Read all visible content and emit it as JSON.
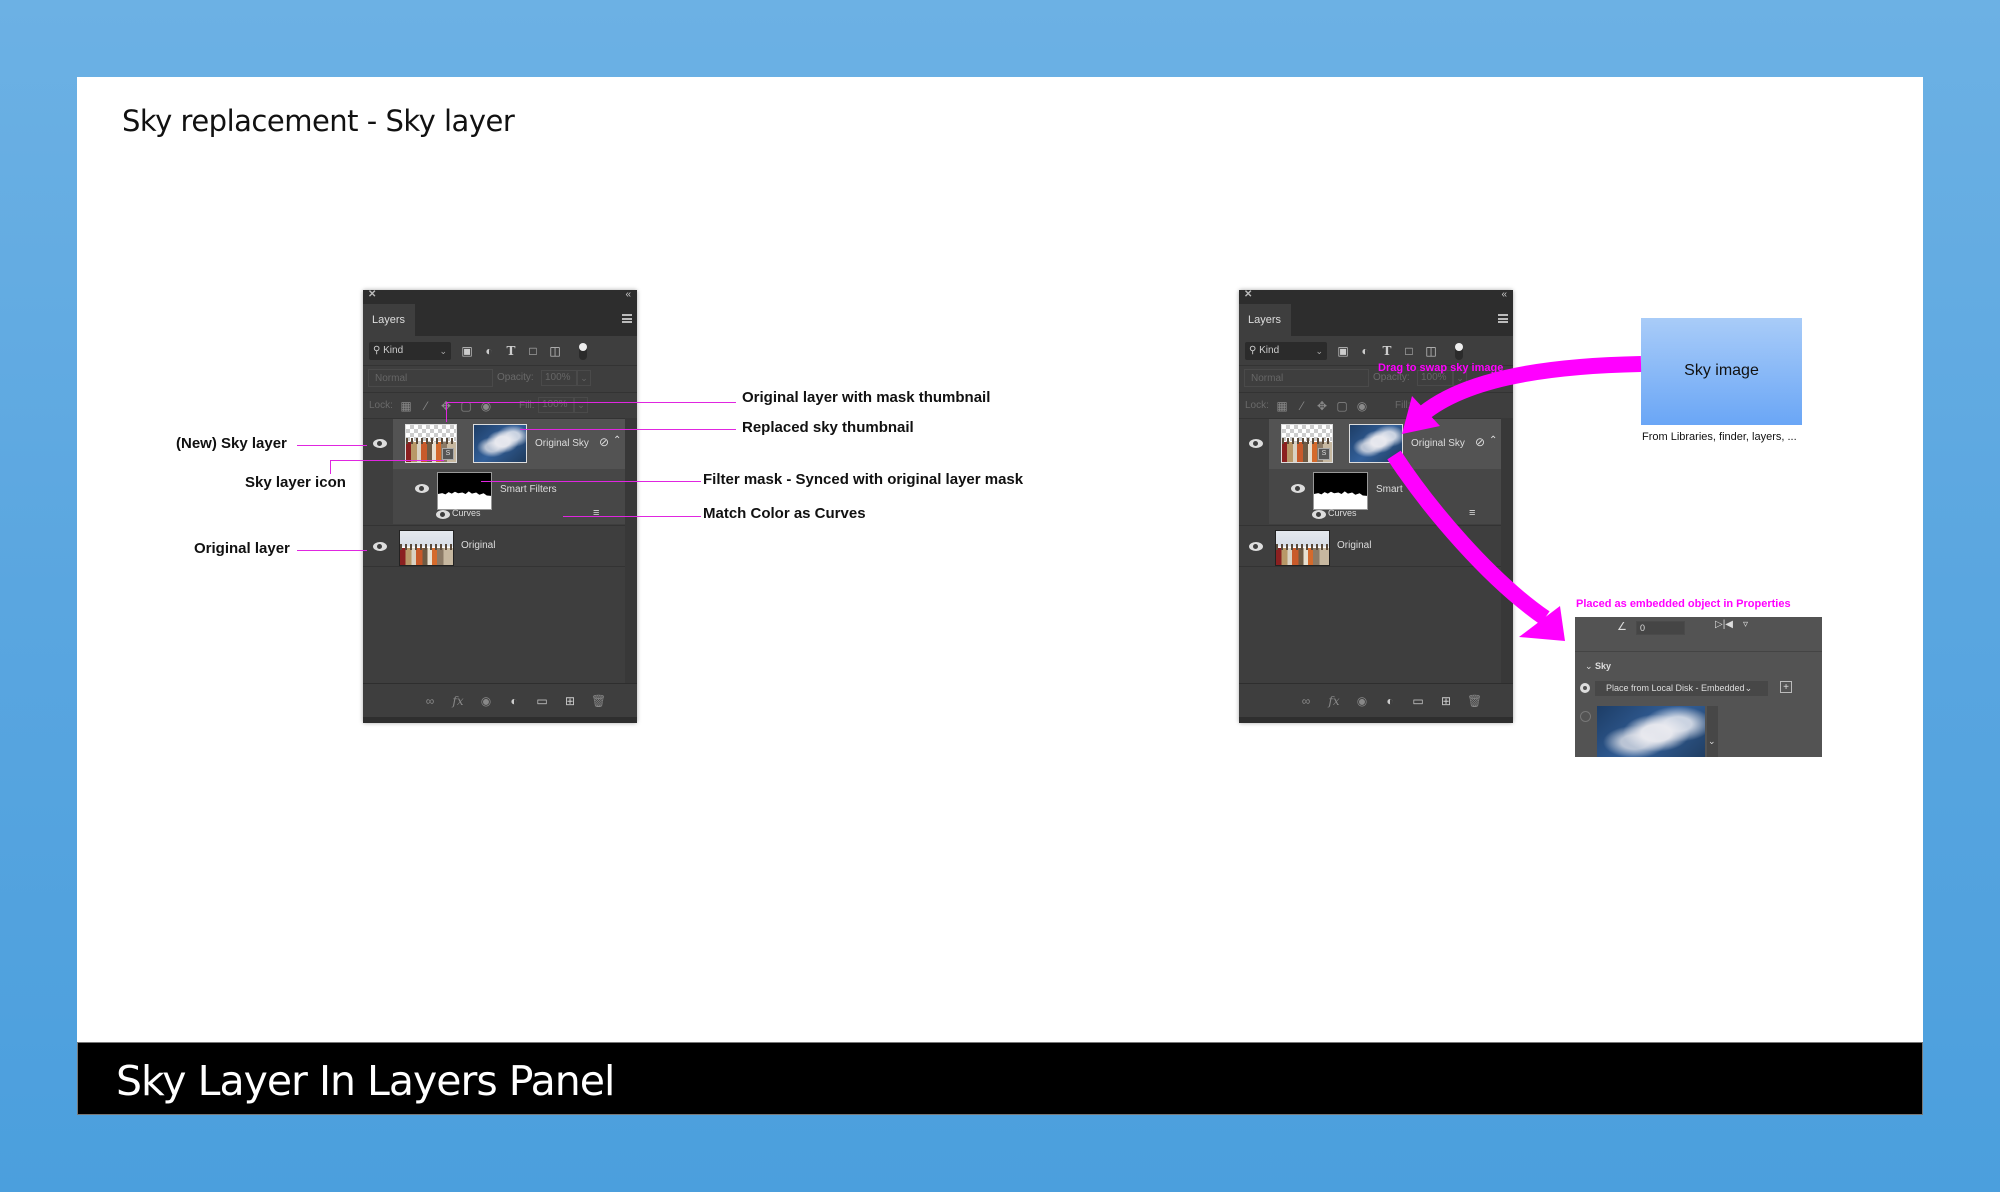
{
  "slide": {
    "title": "Sky replacement - Sky layer",
    "caption": "Sky Layer In Layers Panel"
  },
  "colors": {
    "accent_magenta": "#ff00ff",
    "annotation_line": "#e026e0",
    "panel_bg": "#3e3e3e",
    "sky_box_top": "#a9ccf8",
    "sky_box_bottom": "#6aa6f6"
  },
  "layers_panel": {
    "close_icon": "✕",
    "collapse_icon": "«",
    "tab_label": "Layers",
    "filter": {
      "kind_label": "Kind",
      "icons": [
        "pixel-filter-icon",
        "adjustment-filter-icon",
        "type-filter-icon",
        "shape-filter-icon",
        "smart-object-filter-icon",
        "filter-toggle"
      ]
    },
    "blend_mode": "Normal",
    "opacity_label": "Opacity:",
    "opacity_value": "100%",
    "lock_label": "Lock:",
    "fill_label": "Fill:",
    "fill_value": "100%",
    "layers": [
      {
        "name": "Original Sky",
        "type": "sky-layer",
        "visible": true,
        "badge": "S"
      },
      {
        "name": "Smart Filters",
        "type": "smart-filters",
        "visible": true
      },
      {
        "name": "Curves",
        "type": "filter",
        "visible": true
      },
      {
        "name": "Original",
        "type": "pixel-layer",
        "visible": true
      }
    ],
    "bottom_icons": [
      "link-icon",
      "fx-icon",
      "mask-icon",
      "adjustment-icon",
      "folder-icon",
      "new-layer-icon",
      "trash-icon"
    ],
    "fx_label": "fx"
  },
  "annotations_left": [
    {
      "text": "(New) Sky layer"
    },
    {
      "text": "Sky layer icon"
    },
    {
      "text": "Original layer"
    }
  ],
  "annotations_right": [
    {
      "text": "Original layer with mask thumbnail"
    },
    {
      "text": "Replaced sky thumbnail"
    },
    {
      "text": "Filter mask - Synced with original layer mask"
    },
    {
      "text": "Match Color as Curves"
    }
  ],
  "right_panel": {
    "smart_filters_partial": "Smart",
    "drag_hint": "Drag to swap sky image"
  },
  "sky_image_box": {
    "label": "Sky image",
    "subtitle": "From Libraries, finder, layers, ..."
  },
  "properties": {
    "caption": "Placed as embedded object in Properties",
    "angle_value": "0",
    "section_label": "Sky",
    "source_dropdown": "Place from Local Disk - Embedded",
    "selected_option": "place-from-local-disk"
  }
}
